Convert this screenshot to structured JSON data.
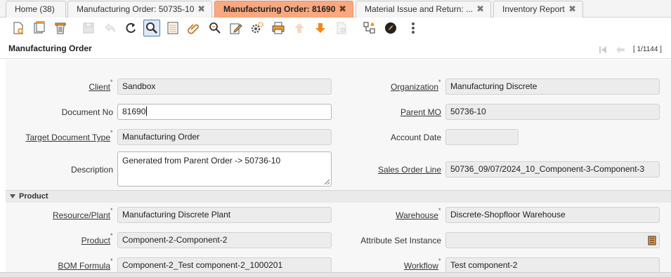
{
  "tabs": [
    {
      "label": "Home (38)",
      "closable": false,
      "active": false
    },
    {
      "label": "Manufacturing Order: 50735-10",
      "closable": true,
      "active": false
    },
    {
      "label": "Manufacturing Order: 81690",
      "closable": true,
      "active": true
    },
    {
      "label": "Material Issue and Return: ...",
      "closable": true,
      "active": false
    },
    {
      "label": "Inventory Report",
      "closable": true,
      "active": false
    }
  ],
  "tab_close_glyph": "✖",
  "toolbar_icons": [
    "new-record-icon",
    "copy-record-icon",
    "delete-icon",
    "save-icon",
    "undo-icon",
    "refresh-icon",
    "find-icon",
    "grid-toggle-icon",
    "attachment-icon",
    "zoom-icon",
    "edit-icon",
    "process-icon",
    "print-icon",
    "previous-icon",
    "next-icon",
    "report-icon",
    "workflow-icon",
    "archive-icon",
    "more-icon"
  ],
  "header": {
    "title": "Manufacturing Order",
    "record_count": "[ 1/1144 ]"
  },
  "fields": {
    "client": {
      "label": "Client",
      "value": "Sandbox"
    },
    "document_no": {
      "label": "Document No",
      "value": "81690"
    },
    "target_doc_type": {
      "label": "Target Document Type",
      "value": "Manufacturing Order"
    },
    "description": {
      "label": "Description",
      "value": "Generated from Parent Order -> 50736-10"
    },
    "organization": {
      "label": "Organization",
      "value": "Manufacturing Discrete"
    },
    "parent_mo": {
      "label": "Parent MO",
      "value": "50736-10"
    },
    "account_date": {
      "label": "Account Date",
      "value": ""
    },
    "sales_order_line": {
      "label": "Sales Order Line",
      "value": "50736_09/07/2024_10_Component-3-Component-3"
    }
  },
  "product_section": {
    "title": "Product",
    "resource_plant": {
      "label": "Resource/Plant",
      "value": "Manufacturing Discrete Plant"
    },
    "product": {
      "label": "Product",
      "value": "Component-2-Component-2"
    },
    "bom_formula": {
      "label": "BOM Formula",
      "value": "Component-2_Test component-2_1000201"
    },
    "warehouse": {
      "label": "Warehouse",
      "value": "Discrete-Shopfloor Warehouse"
    },
    "attribute_set_instance": {
      "label": "Attribute Set Instance",
      "value": ""
    },
    "workflow": {
      "label": "Workflow",
      "value": "Test component-2"
    }
  },
  "required_marker": "*",
  "colors": {
    "active_tab": "#f9a87f",
    "form_bg": "#f7f7f7",
    "field_readonly": "#ececec"
  }
}
